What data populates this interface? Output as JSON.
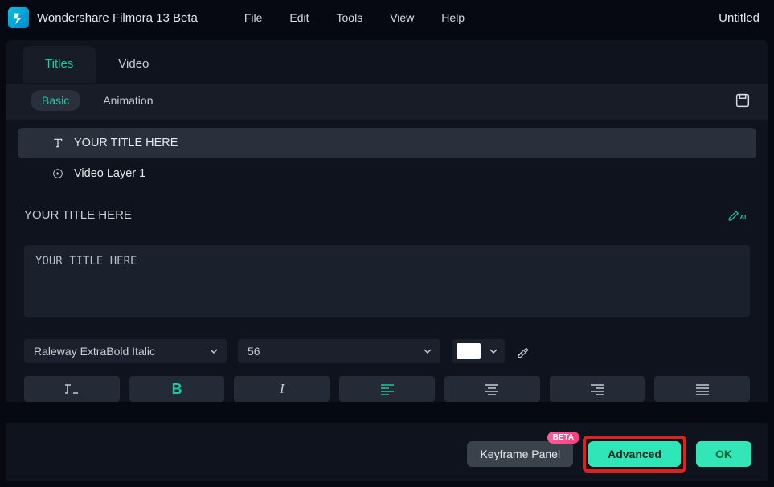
{
  "app": {
    "title": "Wondershare Filmora 13 Beta",
    "document_name": "Untitled"
  },
  "menu": [
    "File",
    "Edit",
    "Tools",
    "View",
    "Help"
  ],
  "tabs": {
    "items": [
      "Titles",
      "Video"
    ],
    "active": 0
  },
  "subtabs": {
    "primary": "Basic",
    "secondary": "Animation"
  },
  "layers": [
    {
      "label": "YOUR TITLE HERE",
      "icon": "text-icon",
      "active": true
    },
    {
      "label": "Video Layer 1",
      "icon": "play-icon",
      "active": false
    }
  ],
  "section": {
    "title": "YOUR TITLE HERE"
  },
  "title_input": {
    "value": "YOUR TITLE HERE"
  },
  "font": {
    "family": "Raleway ExtraBold Italic",
    "size": "56",
    "color": "#ffffff"
  },
  "buttons": {
    "keyframe": "Keyframe Panel",
    "advanced": "Advanced",
    "ok": "OK",
    "beta_badge": "BETA"
  }
}
